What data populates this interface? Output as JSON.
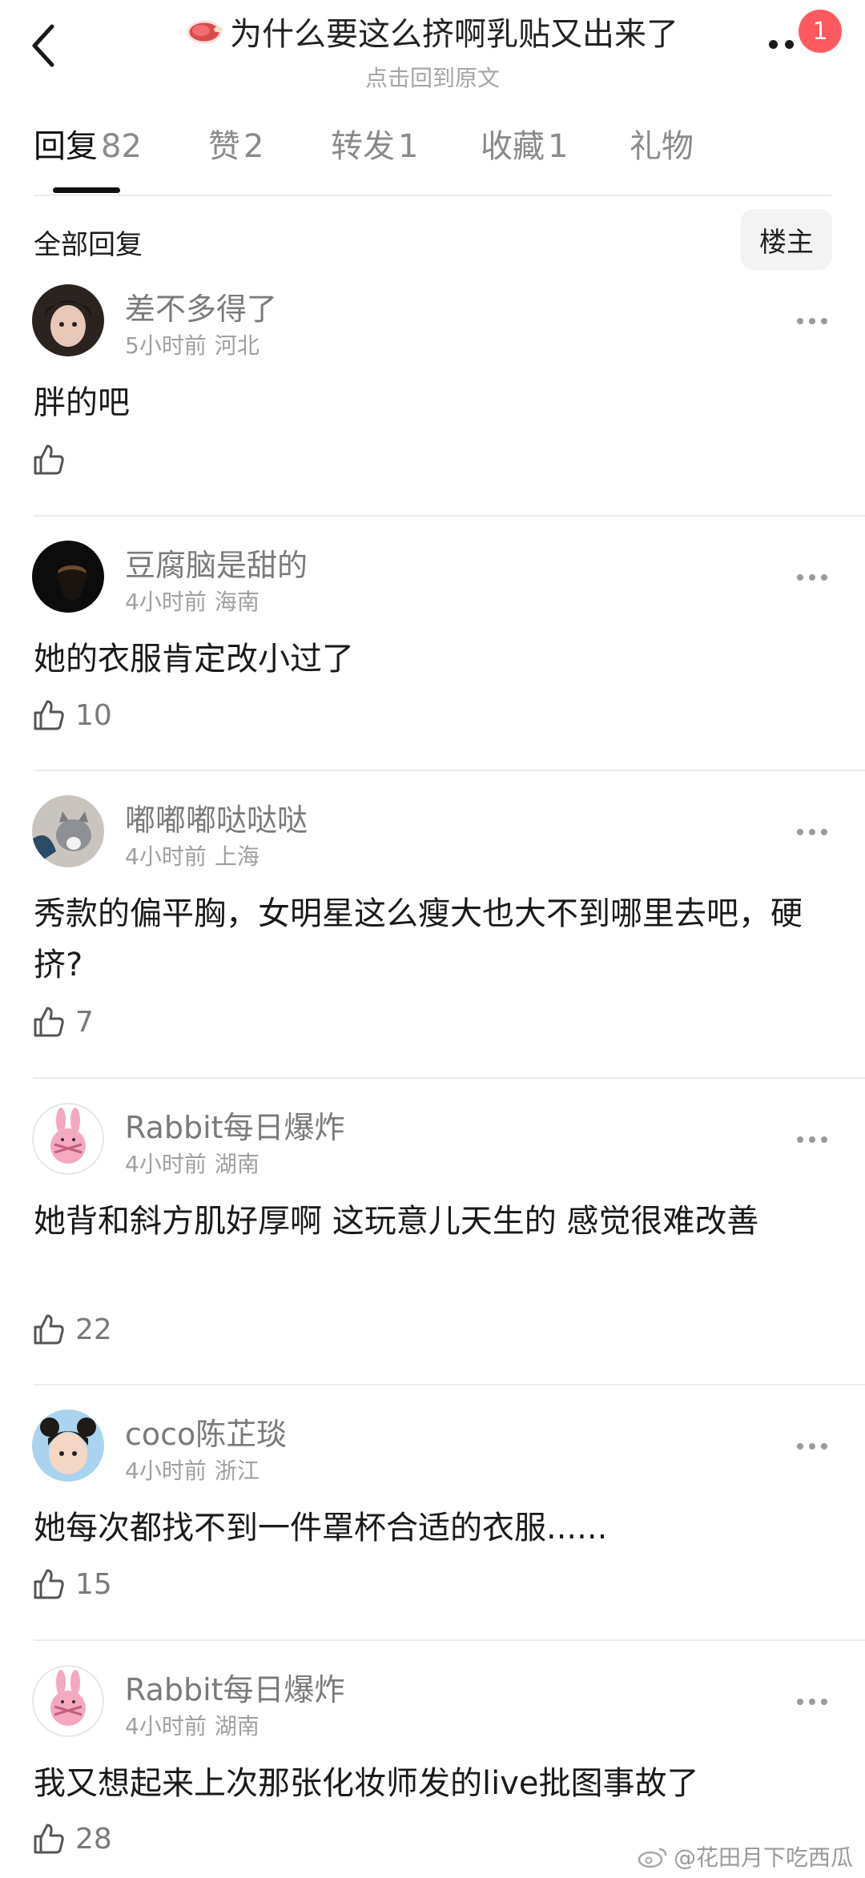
{
  "header": {
    "title": "为什么要这么挤啊乳贴又出来了",
    "subtitle": "点击回到原文",
    "badge_count": "1"
  },
  "tabs": [
    {
      "label": "回复",
      "count": "82"
    },
    {
      "label": "赞",
      "count": "2"
    },
    {
      "label": "转发",
      "count": "1"
    },
    {
      "label": "收藏",
      "count": "1"
    },
    {
      "label": "礼物",
      "count": ""
    }
  ],
  "section": {
    "title": "全部回复",
    "owner_filter": "楼主"
  },
  "comments": [
    {
      "user": "差不多得了",
      "time": "5小时前",
      "location": "河北",
      "text": "胖的吧",
      "likes": ""
    },
    {
      "user": "豆腐脑是甜的",
      "time": "4小时前",
      "location": "海南",
      "text": "她的衣服肯定改小过了",
      "likes": "10"
    },
    {
      "user": "嘟嘟嘟哒哒哒",
      "time": "4小时前",
      "location": "上海",
      "text": "秀款的偏平胸，女明星这么瘦大也大不到哪里去吧，硬挤?",
      "likes": "7"
    },
    {
      "user": "Rabbit每日爆炸",
      "time": "4小时前",
      "location": "湖南",
      "text": "她背和斜方肌好厚啊  这玩意儿天生的 感觉很难改善",
      "likes": "22"
    },
    {
      "user": "coco陈芷琰",
      "time": "4小时前",
      "location": "浙江",
      "text": "她每次都找不到一件罩杯合适的衣服......",
      "likes": "15"
    },
    {
      "user": "Rabbit每日爆炸",
      "time": "4小时前",
      "location": "湖南",
      "text": "我又想起来上次那张化妆师发的live批图事故了",
      "likes": "28"
    }
  ],
  "watermark": "@花田月下吃西瓜",
  "colors": {
    "badge": "#ff5a5f",
    "text_primary": "#1a1a1a",
    "text_secondary": "#7a7a7a"
  }
}
